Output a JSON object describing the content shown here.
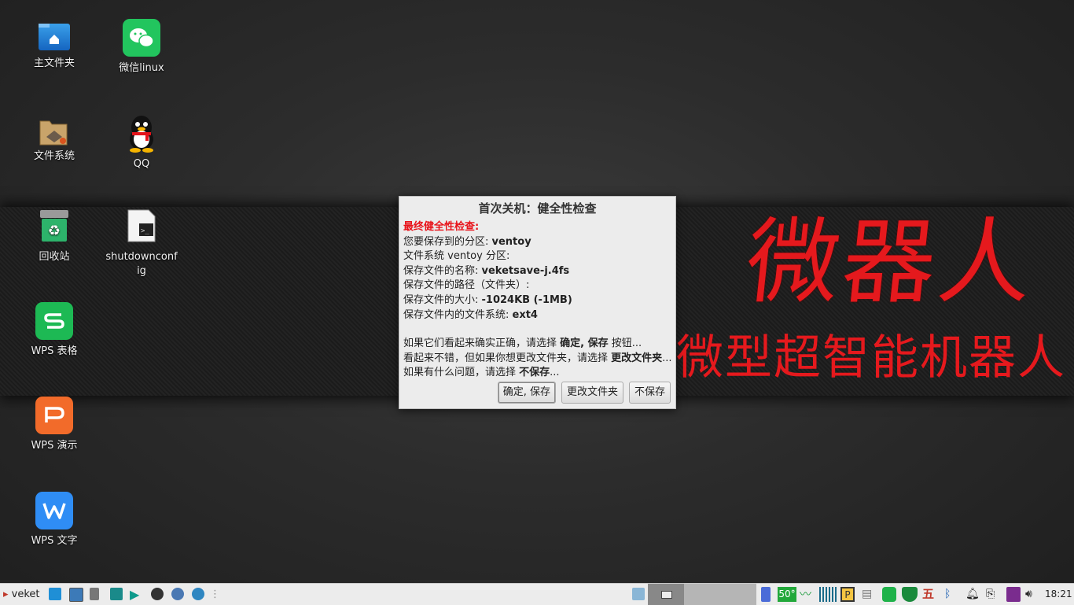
{
  "desktop": {
    "icons": [
      {
        "label": "主文件夹",
        "icon": "home-folder-icon"
      },
      {
        "label": "微信linux",
        "icon": "wechat-icon"
      },
      {
        "label": "文件系统",
        "icon": "filesystem-icon"
      },
      {
        "label": "QQ",
        "icon": "qq-penguin-icon"
      },
      {
        "label": "回收站",
        "icon": "trash-icon"
      },
      {
        "label": "shutdownconfig",
        "icon": "script-file-icon"
      },
      {
        "label": "WPS 表格",
        "icon": "wps-spreadsheet-icon"
      },
      {
        "label": "WPS 演示",
        "icon": "wps-presentation-icon"
      },
      {
        "label": "WPS 文字",
        "icon": "wps-writer-icon"
      }
    ],
    "wallpaper_text": {
      "main": "微器人",
      "sub": "微型超智能机器人",
      "color": "#e5191d"
    }
  },
  "dialog": {
    "title": "首次关机：健全性检查",
    "heading": "最终健全性检查:",
    "partition_label": "您要保存到的分区: ",
    "partition_value": "ventoy",
    "fs_line": "文件系统 ventoy 分区:",
    "name_label": "保存文件的名称: ",
    "name_value": "veketsave-j.4fs",
    "path_line": "保存文件的路径（文件夹）:",
    "size_label": "保存文件的大小: ",
    "size_value": "-1024KB (-1MB)",
    "inner_fs_label": "保存文件内的文件系统: ",
    "inner_fs_value": "ext4",
    "hint1_pre": "如果它们看起来确实正确，请选择 ",
    "hint1_bold": "确定, 保存",
    "hint1_post": " 按钮...",
    "hint2_pre": "看起来不错，但如果你想更改文件夹，请选择 ",
    "hint2_bold": "更改文件夹",
    "hint2_post": "...",
    "hint3_pre": "如果有什么问题，请选择 ",
    "hint3_bold": "不保存",
    "hint3_post": "...",
    "buttons": {
      "ok": "确定, 保存",
      "change": "更改文件夹",
      "nosave": "不保存"
    }
  },
  "taskbar": {
    "menu_label": "veket",
    "battery_level": "50°",
    "clock": "18:21",
    "accent": "#ececec"
  }
}
